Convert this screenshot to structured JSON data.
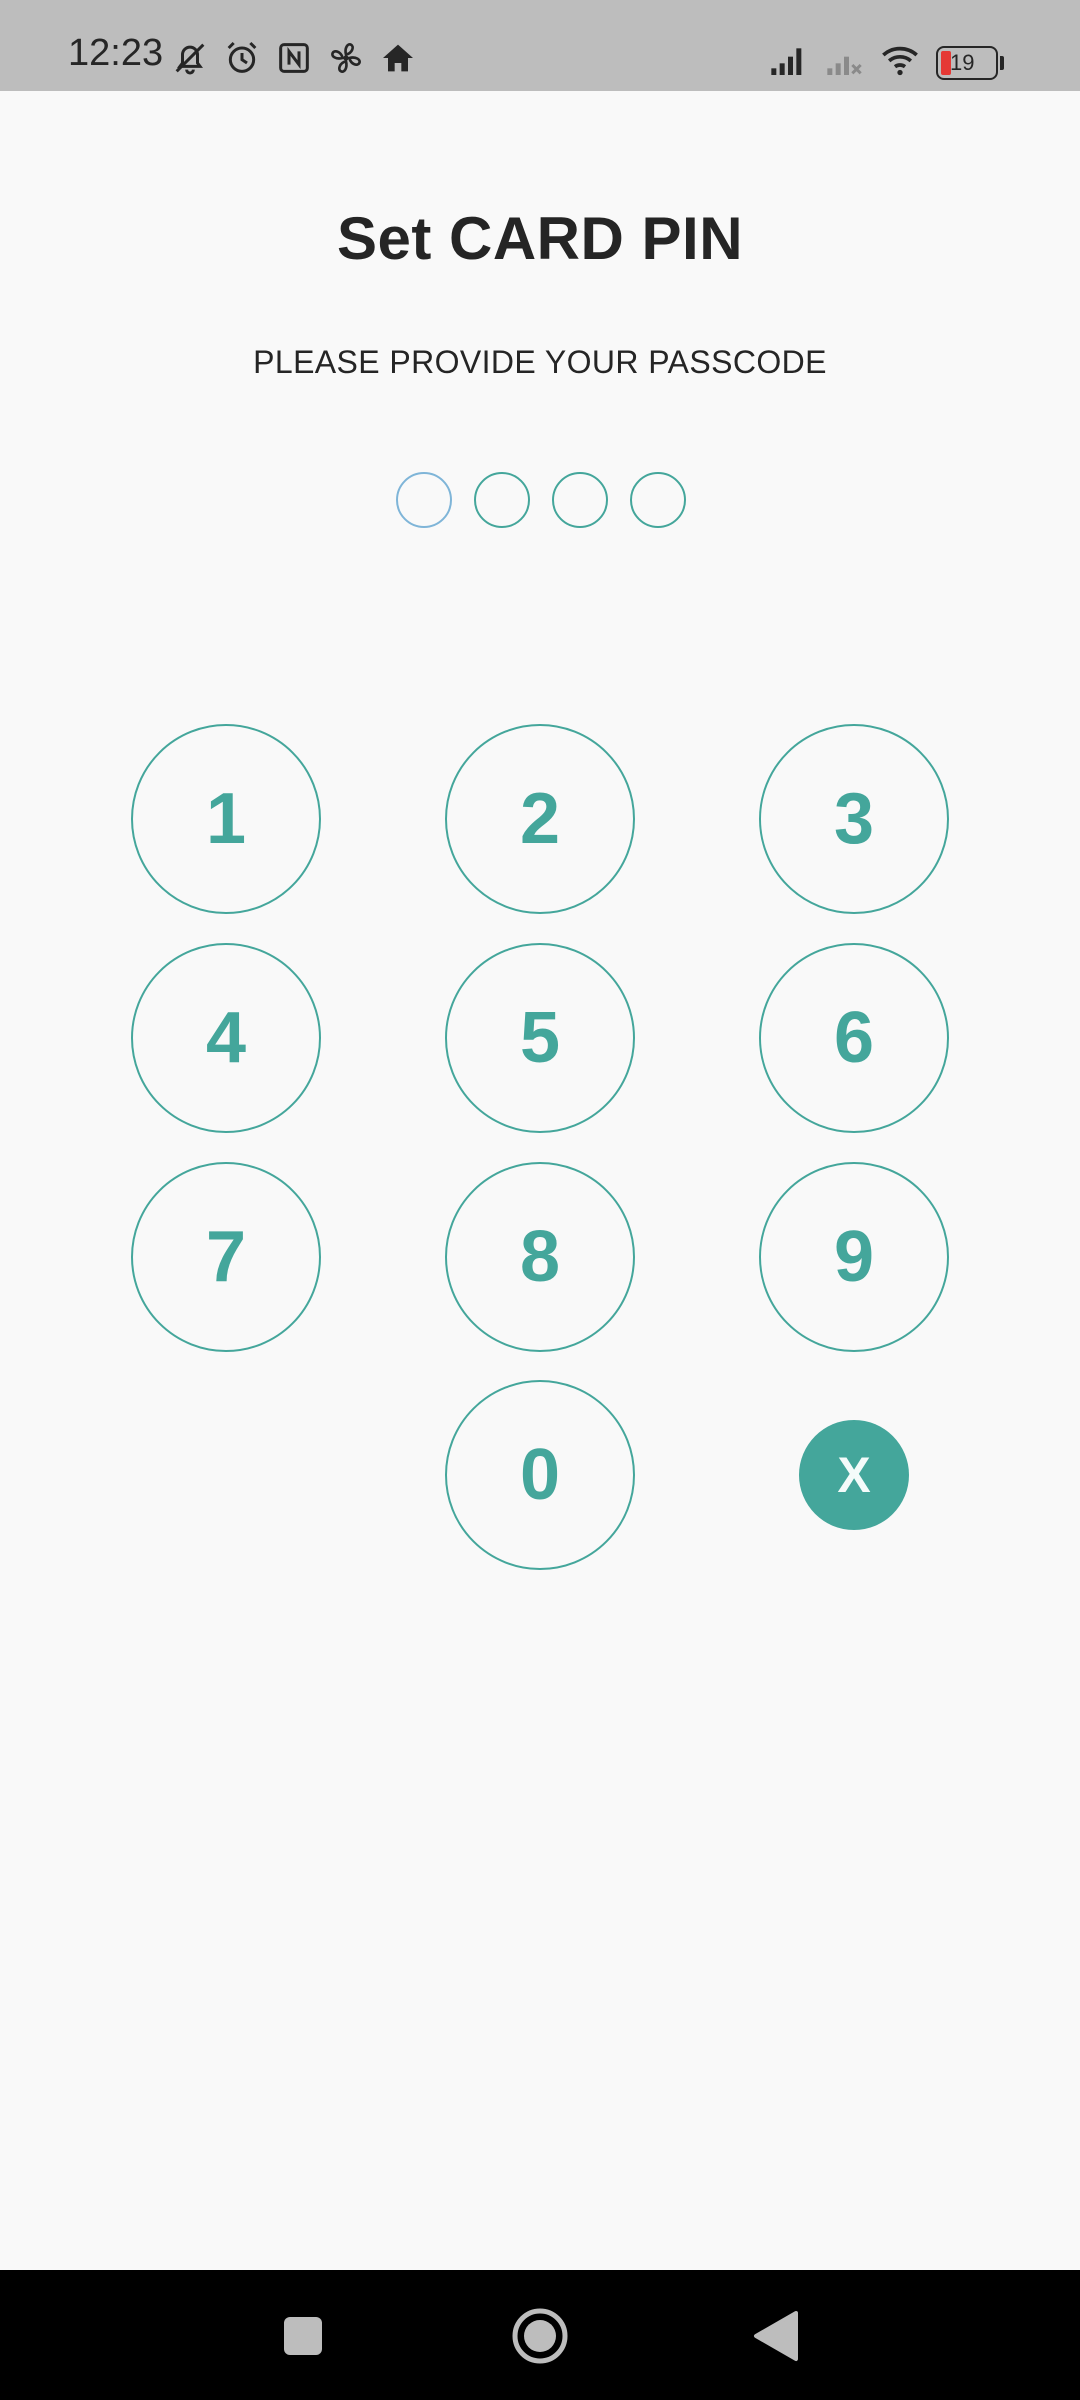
{
  "status_bar": {
    "time": "12:23",
    "left_icons": [
      "mute-icon",
      "alarm-icon",
      "nfc-icon",
      "fan-icon",
      "home-icon"
    ],
    "right_icons": [
      "signal-icon",
      "signal-no-service-icon",
      "wifi-icon",
      "battery-icon"
    ],
    "battery_level": "19",
    "battery_color": "#e53935"
  },
  "screen": {
    "title": "Set CARD PIN",
    "subtitle": "PLEASE PROVIDE YOUR PASSCODE",
    "pin_length": 4,
    "pin_entered": 0
  },
  "keypad": {
    "keys": [
      "1",
      "2",
      "3",
      "4",
      "5",
      "6",
      "7",
      "8",
      "9",
      "0"
    ],
    "clear_label": "X"
  },
  "colors": {
    "accent": "#44a69b",
    "background": "#f9f9f9",
    "status_bar": "#bdbdbd",
    "nav_bar": "#000000"
  },
  "nav_bar": {
    "buttons": [
      "recents-icon",
      "home-circle-icon",
      "back-icon"
    ]
  }
}
